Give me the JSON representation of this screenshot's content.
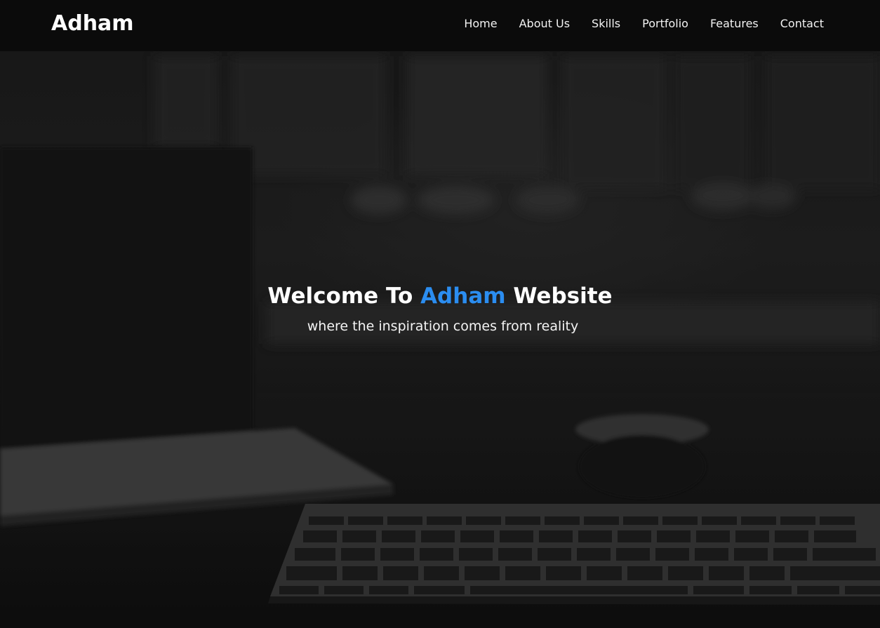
{
  "brand": {
    "name": "Adham"
  },
  "nav": {
    "items": [
      "Home",
      "About Us",
      "Skills",
      "Portfolio",
      "Features",
      "Contact"
    ]
  },
  "hero": {
    "headline_pre": "Welcome To ",
    "headline_accent": "Adham",
    "headline_post": " Website",
    "tagline": "where the inspiration comes from reality",
    "accent_color": "#2b8df0"
  }
}
